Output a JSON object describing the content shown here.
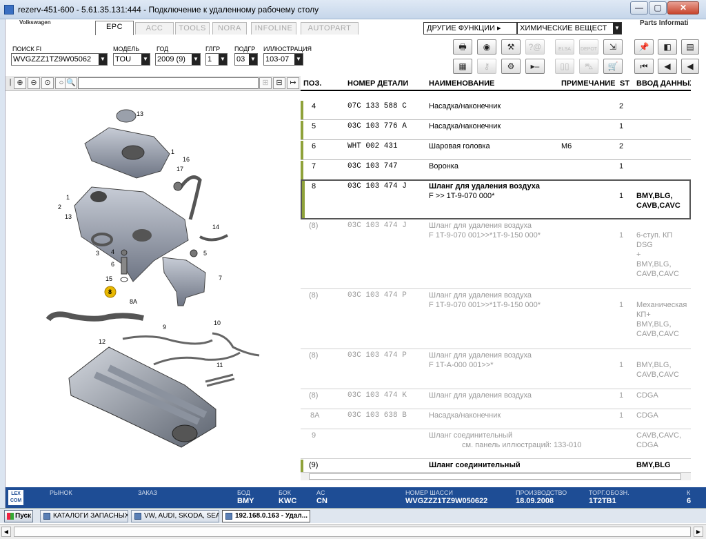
{
  "window": {
    "title": "rezerv-451-600 - 5.61.35.131:444 - Подключение к удаленному рабочему столу",
    "min": "—",
    "max": "▢",
    "close": "✕"
  },
  "app": {
    "brand": "Volkswagen",
    "tabs": [
      "EPC",
      "ACC",
      "TOOLS",
      "NORA",
      "INFOLINE",
      "AUTOPART"
    ],
    "active_tab": "EPC",
    "other_functions": "ДРУГИЕ ФУНКЦИИ ▸",
    "chem_select": "ХИМИЧЕСКИЕ ВЕЩЕСТ",
    "parts_info": "Parts Informati"
  },
  "fields": {
    "search_label": "ПОИСК FI",
    "search_value": "WVGZZZ1TZ9W05062",
    "model_label": "МОДЕЛЬ",
    "model_value": "TOU",
    "year_label": "ГОД",
    "year_value": "2009 (9)",
    "group_label": "ГЛГР",
    "group_value": "1",
    "subgroup_label": "ПОДГР",
    "subgroup_value": "03",
    "illustration_label": "ИЛЛЮСТРАЦИЯ",
    "illustration_value": "103-07"
  },
  "toolbar_icons": {
    "row1": [
      "printer-icon",
      "disc-icon",
      "car-tools-icon",
      "help-query-icon",
      "elsa-icon",
      "depot-icon",
      "cart-arrow-icon",
      "pin-icon",
      "list-back-icon",
      "list-icon"
    ],
    "row2": [
      "table-icon",
      "key-icon",
      "bike-icon",
      "play-next-icon",
      "car-compare-icon",
      "car-broken-icon",
      "cart-icon",
      "first-icon",
      "prev-icon",
      "prev2-icon"
    ],
    "elsa": "ELSA",
    "depot": "DEPOT"
  },
  "table": {
    "headers": {
      "pos": "ПОЗ.",
      "part_no": "НОМЕР ДЕТАЛИ",
      "name": "НАИМЕНОВАНИЕ",
      "note": "ПРИМЕЧАНИЕ",
      "st": "ST",
      "input": "ВВОД ДАННЫХ"
    },
    "rows": [
      {
        "pos": "4",
        "part": "07C 133 588 C",
        "name": "Насадка/наконечник",
        "name2": "",
        "note": "",
        "st": "2",
        "input": "",
        "input2": "",
        "input3": "",
        "input4": "",
        "dim": false
      },
      {
        "pos": "5",
        "part": "03C 103 776 A",
        "name": "Насадка/наконечник",
        "name2": "",
        "note": "",
        "st": "1",
        "input": "",
        "input2": "",
        "input3": "",
        "input4": "",
        "dim": false
      },
      {
        "pos": "6",
        "part": "WHT 002 431",
        "name": "Шаровая головка",
        "name2": "",
        "note": "M6",
        "st": "2",
        "input": "",
        "input2": "",
        "input3": "",
        "input4": "",
        "dim": false
      },
      {
        "pos": "7",
        "part": "03C 103 747",
        "name": "Воронка",
        "name2": "",
        "note": "",
        "st": "1",
        "input": "",
        "input2": "",
        "input3": "",
        "input4": "",
        "dim": false
      },
      {
        "pos": "8",
        "part": "03C 103 474 J",
        "name": "Шланг для удаления воздуха",
        "name2": "F            >> 1T-9-070 000*",
        "note": "",
        "st": "1",
        "input": "BMY,BLG,",
        "input2": "CAVB,CAVC",
        "input3": "",
        "input4": "",
        "dim": false
      },
      {
        "pos": "(8)",
        "part": "03C 103 474 J",
        "name": "Шланг для удаления воздуха",
        "name2": "F 1T-9-070 001>>*1T-9-150 000*",
        "note": "",
        "st": "1",
        "input": "6-ступ. КП",
        "input2": "DSG",
        "input3": "+",
        "input4": "BMY,BLG,",
        "input5": "CAVB,CAVC",
        "dim": true
      },
      {
        "pos": "(8)",
        "part": "03C 103 474 P",
        "name": "Шланг для удаления воздуха",
        "name2": "F 1T-9-070 001>>*1T-9-150 000*",
        "note": "",
        "st": "1",
        "input": "Механическая",
        "input2": "КП+",
        "input3": "BMY,BLG,",
        "input4": "CAVB,CAVC",
        "dim": true
      },
      {
        "pos": "(8)",
        "part": "03C 103 474 P",
        "name": "Шланг для удаления воздуха",
        "name2": "F 1T-A-000 001>>*",
        "note": "",
        "st": "1",
        "input": "BMY,BLG,",
        "input2": "CAVB,CAVC",
        "input3": "",
        "input4": "",
        "dim": true
      },
      {
        "pos": "(8)",
        "part": "03C 103 474 K",
        "name": "Шланг для удаления воздуха",
        "name2": "",
        "note": "",
        "st": "1",
        "input": "CDGA",
        "input2": "",
        "input3": "",
        "input4": "",
        "dim": true
      },
      {
        "pos": "8A",
        "part": "03C 103 638 B",
        "name": "Насадка/наконечник",
        "name2": "",
        "note": "",
        "st": "1",
        "input": "CDGA",
        "input2": "",
        "input3": "",
        "input4": "",
        "dim": true
      },
      {
        "pos": "9",
        "part": "",
        "name": "Шланг соединительный",
        "name2": "см. панель иллюстраций:   133-010",
        "note": "",
        "st": "",
        "input": "CAVB,CAVC,",
        "input2": "CDGA",
        "input3": "",
        "input4": "",
        "dim": true
      },
      {
        "pos": "(9)",
        "part": "",
        "name": "Шланг соединительный",
        "name2": "",
        "note": "",
        "st": "",
        "input": "BMY,BLG",
        "input2": "",
        "input3": "",
        "input4": "",
        "dim": false
      }
    ]
  },
  "illustration": {
    "callouts": [
      "13",
      "1",
      "16",
      "17",
      "2",
      "1",
      "13",
      "14",
      "3",
      "4",
      "5",
      "6",
      "7",
      "15",
      "8",
      "8A",
      "9",
      "10",
      "12",
      "11"
    ]
  },
  "status": {
    "logo": "LEX COM",
    "market_label": "РЫНОК",
    "market_value": "",
    "order_label": "ЗАКАЗ",
    "order_value": "",
    "bod_label": "БОД",
    "bod_value": "BMY",
    "bok_label": "БОК",
    "bok_value": "KWC",
    "ac_label": "AC",
    "ac_value": "CN",
    "chassis_label": "НОМЕР ШАССИ",
    "chassis_value": "WVGZZZ1TZ9W050622",
    "prod_label": "ПРОИЗВОДСТВО",
    "prod_value": "18.09.2008",
    "trade_label": "ТОРГ.ОБОЗН.",
    "trade_value": "1T2TB1",
    "k_label": "К",
    "k_value": "6"
  },
  "taskbar": {
    "start": "Пуск",
    "items": [
      "КАТАЛОГИ ЗАПАСНЫХ ...",
      "VW, AUDI, SKODA, SEAT",
      "192.168.0.163 - Удал..."
    ]
  }
}
